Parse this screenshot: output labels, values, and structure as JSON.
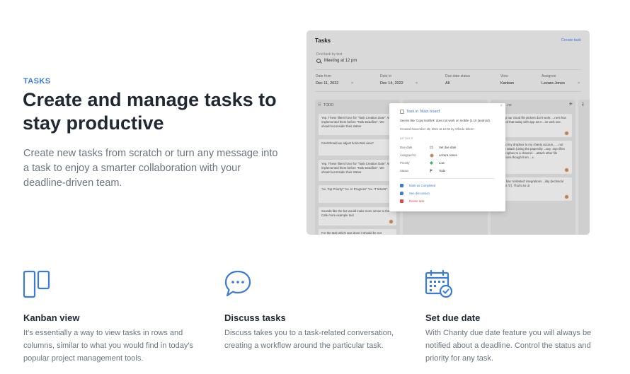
{
  "hero": {
    "eyebrow": "TASKS",
    "title": "Create and manage tasks to stay productive",
    "description": "Create new tasks from scratch or turn any message into a task to enjoy a smarter collaboration with your deadline-driven team."
  },
  "screenshot": {
    "title": "Tasks",
    "create_link": "Create task",
    "find_label": "Find task by text",
    "find_value": "Meeting at 12 pm",
    "filters": [
      {
        "label": "Date from",
        "value": "Dec 11, 2022",
        "clearable": true
      },
      {
        "label": "Date to",
        "value": "Dec 14, 2022",
        "clearable": true
      },
      {
        "label": "Due date status",
        "value": "All",
        "clearable": false
      },
      {
        "label": "View",
        "value": "Kanban",
        "clearable": false
      },
      {
        "label": "Assignee",
        "value": "Lezara Jones",
        "clearable": true
      }
    ],
    "clear_symbol": "×",
    "columns": [
      {
        "name": "TODO"
      },
      {
        "name": ""
      },
      {
        "name": "...ne"
      }
    ],
    "cards_todo": [
      "Yep. These filters force for \"Task Creation Date\". We implemented them before \"Task Deadline\". We should reconsider their status.",
      "Can/Should we adjust horizontal view?",
      "Yep. These filters force for \"Task Creation Date\". We implemented them before \"Task Deadline\". We should reconsider their status.",
      "\"ex. Top Priority\" \"ex. In Progress\" \"ex. IT tickets\"",
      "Sounds like the bot would make more sense to the Cafe more example tool",
      "For the task which was done it should be not"
    ],
    "cards_done": [
      "...ed up our cloud file pickers don't work. ...ners has reported that today with app 12.3 ...ne web one.",
      "...linked my dropbox to my chanty accoun... ...not able to attach (using the paperclip ...any .mp4 files from dropbox to a channel. ...attach other file extensions though from ...x.",
      "...alue has 'unlimited' integrations ...ility (technical value is '0'). That's an UI"
    ],
    "popover": {
      "title": "Task in 'Main board'",
      "description": "Seems like 'Copy text/link' does not work on mobile (1.10 (android).",
      "meta": "Created November 18, 2021 at 12:06 by Alfredo Siltorn",
      "details_label": "DETAILS",
      "rows": [
        {
          "key": "Due date",
          "value": "Set due date",
          "icon": "calendar-icon"
        },
        {
          "key": "Assigned to",
          "value": "Lezara Jones",
          "icon": "avatar"
        },
        {
          "key": "Priority",
          "value": "Low",
          "icon": "diamond-icon"
        },
        {
          "key": "Status",
          "value": "Todo",
          "icon": "flag-icon"
        }
      ],
      "actions": [
        {
          "label": "Mark as Completed",
          "color": "#3a7bd5"
        },
        {
          "label": "See discussion",
          "color": "#3a7bd5"
        },
        {
          "label": "Delete task",
          "color": "#e04b4b"
        }
      ],
      "close": "×"
    }
  },
  "features": [
    {
      "icon": "kanban-icon",
      "title": "Kanban view",
      "description": "It's essentially a way to view tasks in rows and columns, similar to what you would find in today's popular project management tools."
    },
    {
      "icon": "chat-bubble-icon",
      "title": "Discuss tasks",
      "description": "Discuss takes you to a task-related conversation, creating a workflow around the particular task."
    },
    {
      "icon": "calendar-check-icon",
      "title": "Set due date",
      "description": "With Chanty due date feature you will always be notified about a deadline. Control the status and priority for any task."
    }
  ],
  "colors": {
    "accent": "#3a7bd5",
    "text": "#1f2833",
    "muted": "#6b7480",
    "danger": "#e04b4b"
  }
}
